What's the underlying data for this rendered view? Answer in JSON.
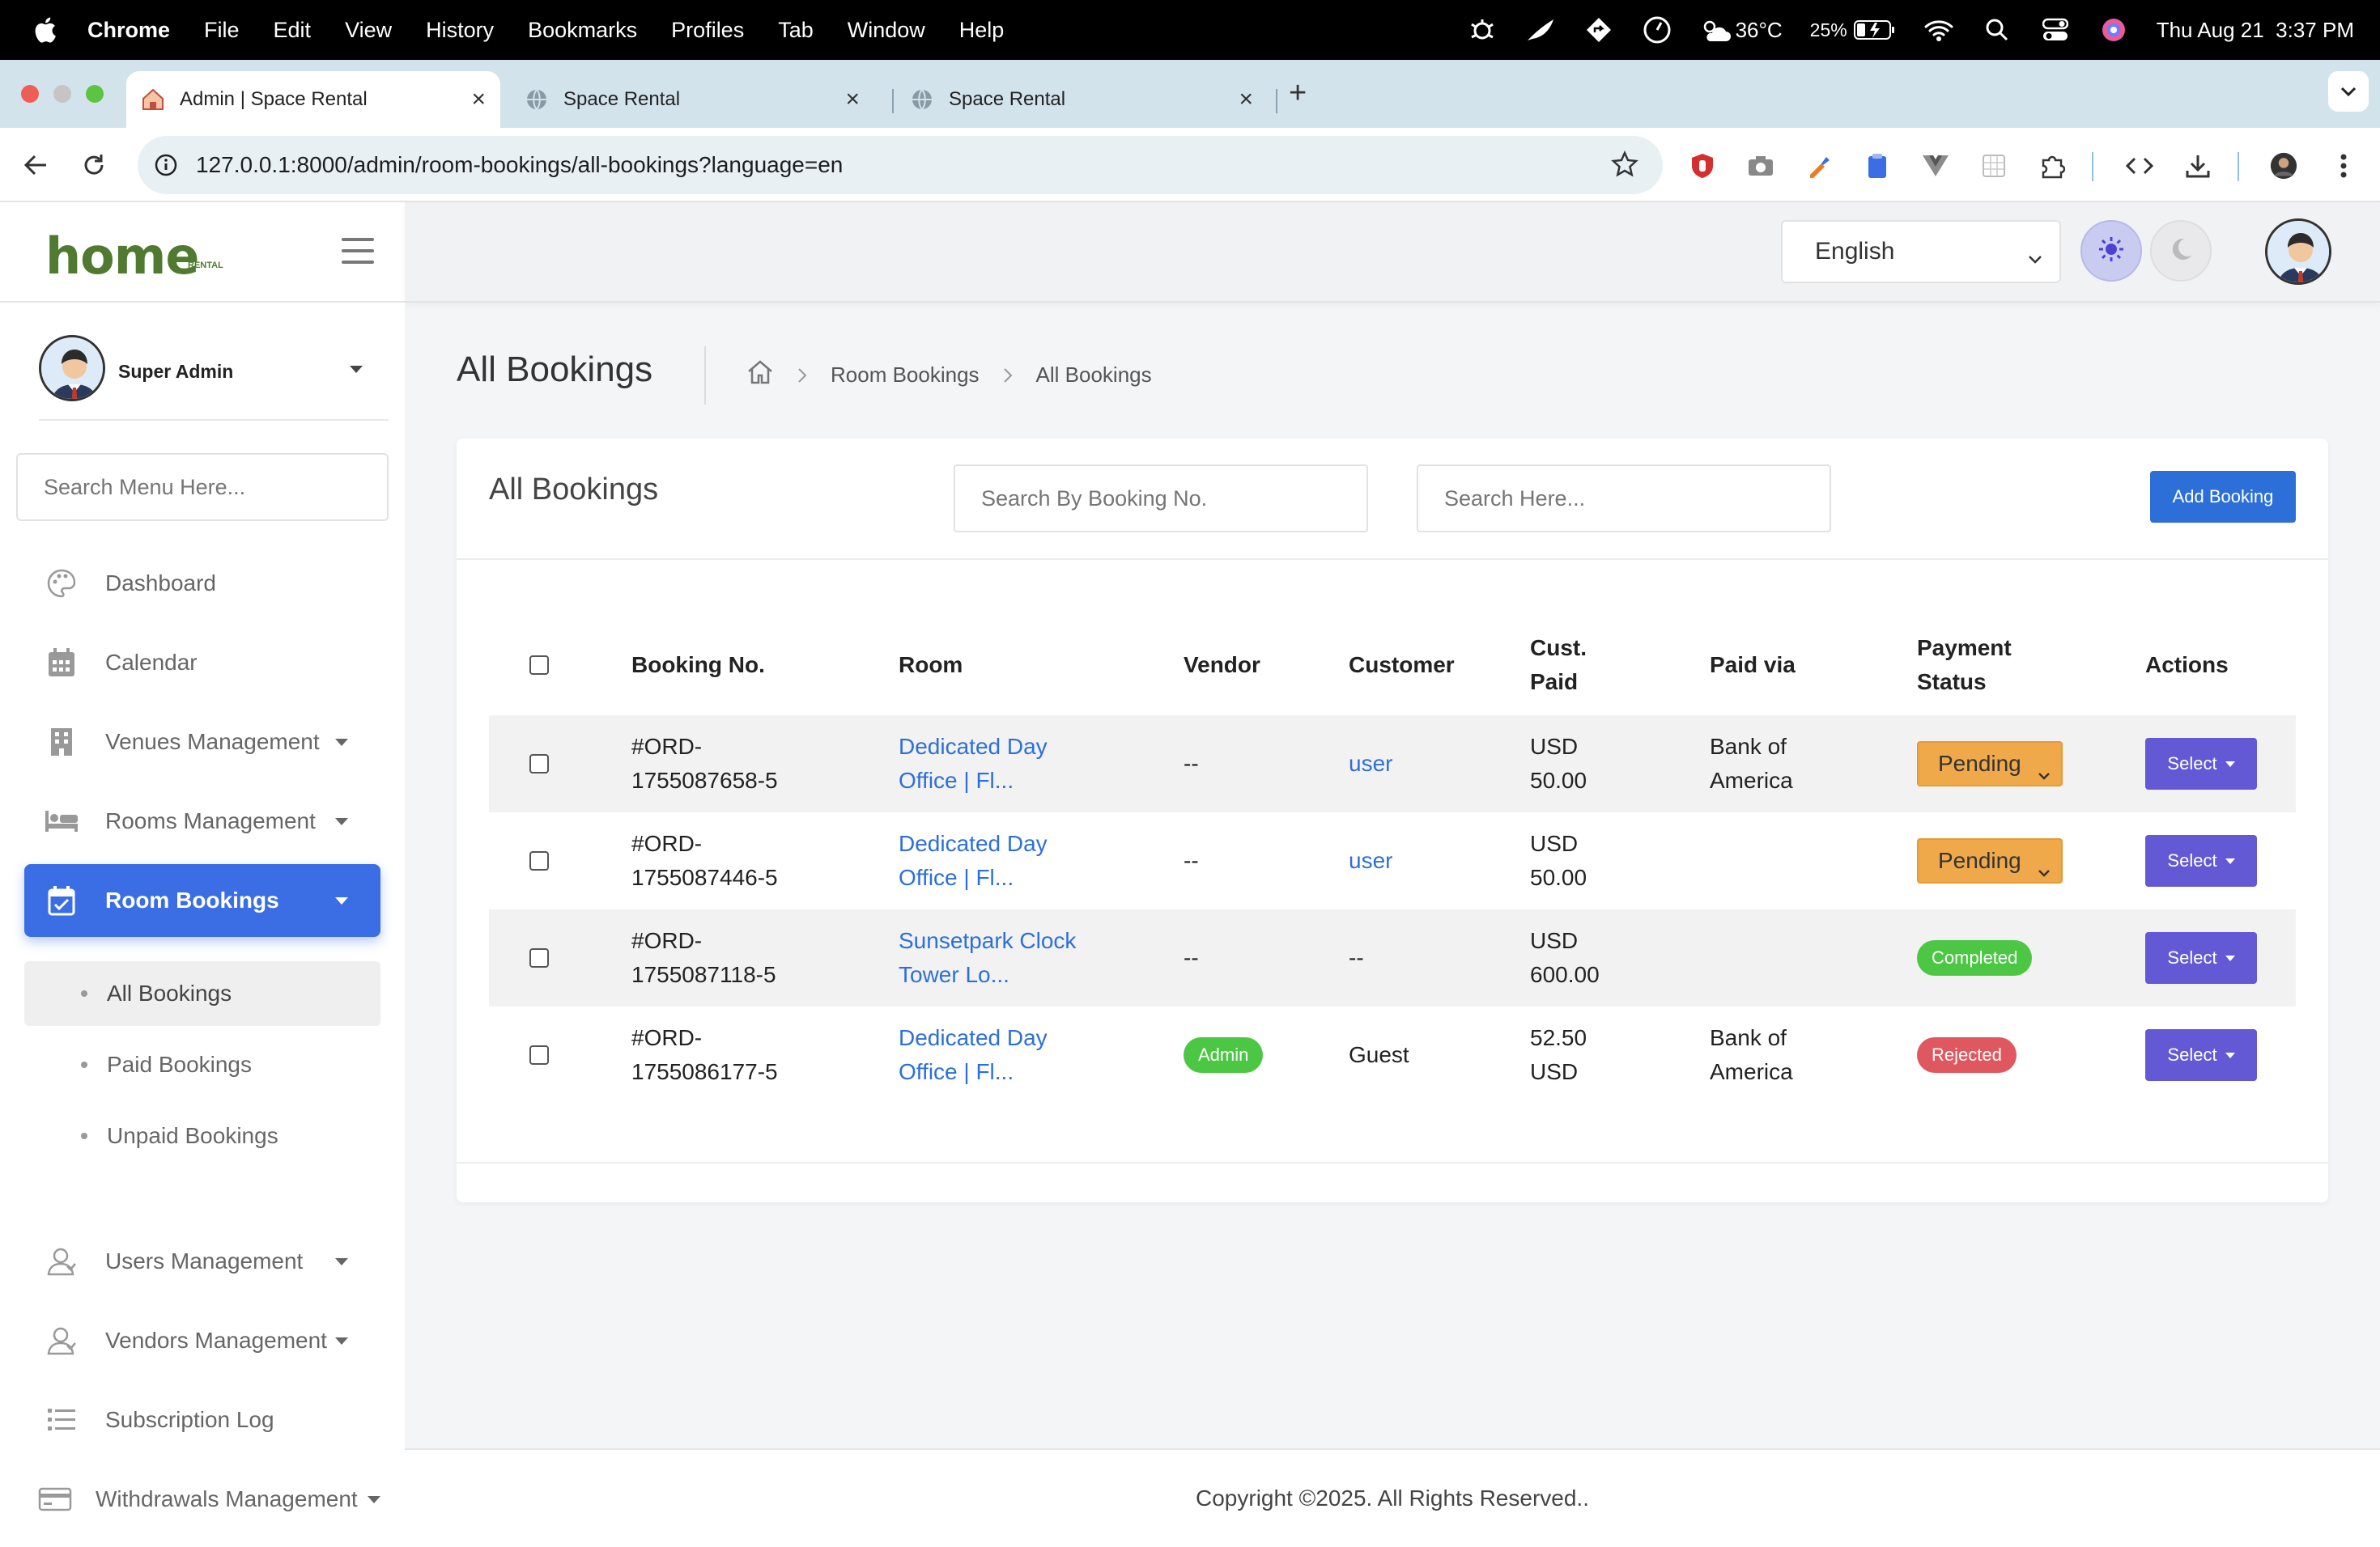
{
  "menubar": {
    "app": "Chrome",
    "items": [
      "File",
      "Edit",
      "View",
      "History",
      "Bookmarks",
      "Profiles",
      "Tab",
      "Window",
      "Help"
    ],
    "weather": "36°C",
    "battery": "25%",
    "datetime": "Thu Aug 21  3:37 PM"
  },
  "tabs": [
    {
      "title": "Admin | Space Rental"
    },
    {
      "title": "Space Rental"
    },
    {
      "title": "Space Rental"
    }
  ],
  "address_bar": {
    "url": "127.0.0.1:8000/admin/room-bookings/all-bookings?language=en"
  },
  "brand": {
    "logo": "home",
    "sub": "RENTAL"
  },
  "topbar": {
    "language": "English"
  },
  "sidebar": {
    "user_name": "Super Admin",
    "search_placeholder": "Search Menu Here...",
    "items": [
      {
        "label": "Dashboard",
        "icon": "palette-icon"
      },
      {
        "label": "Calendar",
        "icon": "calendar-icon"
      },
      {
        "label": "Venues Management",
        "icon": "building-icon"
      },
      {
        "label": "Rooms Management",
        "icon": "bed-icon"
      },
      {
        "label": "Room Bookings",
        "icon": "calendar-check-icon"
      },
      {
        "label": "Users Management",
        "icon": "users-icon"
      },
      {
        "label": "Vendors Management",
        "icon": "vendors-icon"
      },
      {
        "label": "Subscription Log",
        "icon": "list-icon"
      },
      {
        "label": "Withdrawals Management",
        "icon": "credit-card-icon"
      }
    ],
    "subitems": [
      "All Bookings",
      "Paid Bookings",
      "Unpaid Bookings"
    ]
  },
  "page": {
    "title": "All Bookings",
    "breadcrumb": [
      "Room Bookings",
      "All Bookings"
    ]
  },
  "card": {
    "title": "All Bookings",
    "search_booking_placeholder": "Search By Booking No.",
    "search_placeholder": "Search Here...",
    "add_button": "Add Booking"
  },
  "table": {
    "headers": {
      "booking_no": "Booking No.",
      "room": "Room",
      "vendor": "Vendor",
      "customer": "Customer",
      "cust_paid": "Cust. Paid",
      "paid_via": "Paid via",
      "payment_status": "Payment Status",
      "actions": "Actions"
    },
    "rows": [
      {
        "booking_no": "#ORD-1755087658-5",
        "room": "Dedicated Day Office | Fl...",
        "vendor": "--",
        "customer": "user",
        "cust_paid": "USD 50.00",
        "paid_via": "Bank of America",
        "status": "Pending",
        "action": "Select"
      },
      {
        "booking_no": "#ORD-1755087446-5",
        "room": "Dedicated Day Office | Fl...",
        "vendor": "--",
        "customer": "user",
        "cust_paid": "USD 50.00",
        "paid_via": "",
        "status": "Pending",
        "action": "Select"
      },
      {
        "booking_no": "#ORD-1755087118-5",
        "room": "Sunsetpark Clock Tower Lo...",
        "vendor": "--",
        "customer": "--",
        "cust_paid": "USD 600.00",
        "paid_via": "",
        "status": "Completed",
        "action": "Select"
      },
      {
        "booking_no": "#ORD-1755086177-5",
        "room": "Dedicated Day Office | Fl...",
        "vendor": "Admin",
        "customer": "Guest",
        "cust_paid": "52.50 USD",
        "paid_via": "Bank of America",
        "status": "Rejected",
        "action": "Select"
      }
    ]
  },
  "footer": {
    "copyright": "Copyright ©2025. All Rights Reserved.."
  },
  "colors": {
    "primary": "#3b6ee5",
    "pending": "#f0a94a",
    "completed": "#4cc744",
    "rejected": "#e0585f",
    "action": "#6359d4",
    "brand": "#4f7a2f"
  }
}
